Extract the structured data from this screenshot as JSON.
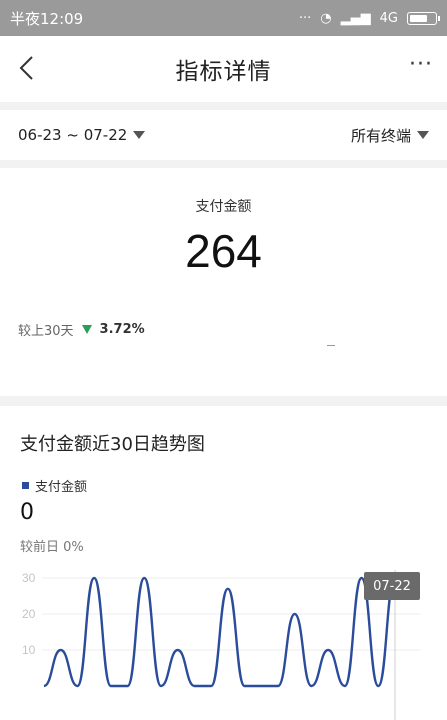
{
  "statusbar": {
    "time": "半夜12:09",
    "network": "4G"
  },
  "nav": {
    "title": "指标详情",
    "more": "···"
  },
  "filter": {
    "range": "06-23 ~ 07-22",
    "terminal": "所有终端"
  },
  "summary": {
    "label": "支付金额",
    "value": "264",
    "compare_label": "较上30天",
    "compare_value": "3.72%"
  },
  "trend": {
    "title": "支付金额近30日趋势图",
    "legend": "支付金额",
    "value": "0",
    "compare": "较前日 0%",
    "tooltip": "07-22"
  },
  "chart_data": {
    "type": "line",
    "series": [
      {
        "name": "支付金额",
        "values": [
          0,
          10,
          0,
          30,
          0,
          0,
          30,
          0,
          10,
          0,
          0,
          27,
          0,
          0,
          0,
          20,
          0,
          10,
          0,
          30,
          0,
          30
        ]
      }
    ],
    "yticks": [
      "30",
      "20",
      "10"
    ],
    "ylim": [
      0,
      30
    ],
    "colors": {
      "line": "#2b4c9b"
    }
  }
}
